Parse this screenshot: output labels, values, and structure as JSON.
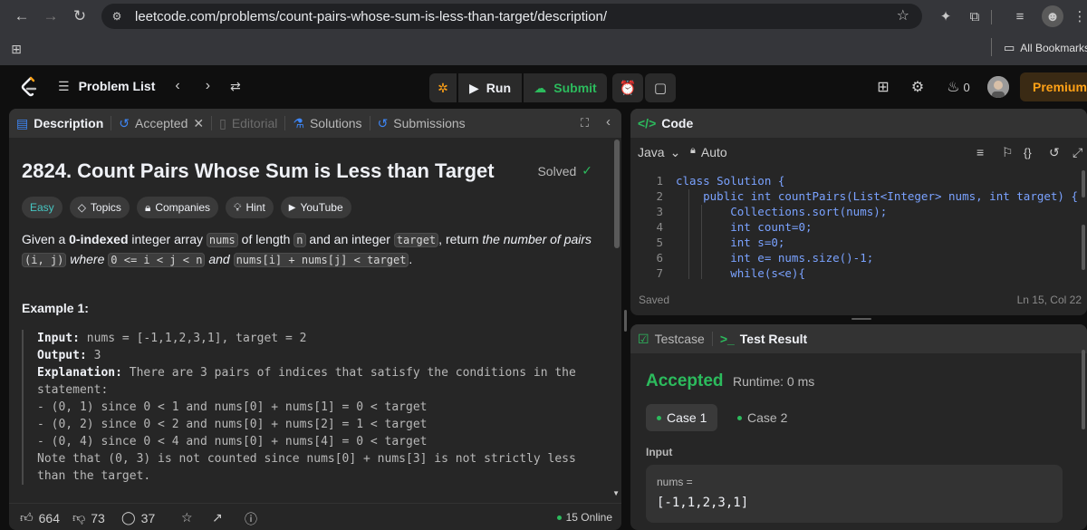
{
  "browser": {
    "url": "leetcode.com/problems/count-pairs-whose-sum-is-less-than-target/description/",
    "bookmarks_label": "All Bookmarks"
  },
  "header": {
    "problem_list": "Problem List",
    "run": "Run",
    "submit": "Submit",
    "streak_count": "0",
    "premium": "Premium"
  },
  "left_tabs": {
    "description": "Description",
    "accepted": "Accepted",
    "editorial": "Editorial",
    "solutions": "Solutions",
    "submissions": "Submissions"
  },
  "problem": {
    "title": "2824. Count Pairs Whose Sum is Less than Target",
    "solved": "Solved",
    "chips": {
      "difficulty": "Easy",
      "topics": "Topics",
      "companies": "Companies",
      "hint": "Hint",
      "youtube": "YouTube"
    },
    "desc": {
      "t1": "Given a ",
      "b1": "0-indexed",
      "t2": " integer array ",
      "c1": "nums",
      "t3": " of length ",
      "c2": "n",
      "t4": " and an integer ",
      "c3": "target",
      "t5": ", return ",
      "i1": "the number of pairs",
      "c4": "(i, j)",
      "i2": "where",
      "c5": "0 <= i < j < n",
      "i3": "and",
      "c6": "nums[i] + nums[j] < target",
      "t6": "."
    },
    "example_title": "Example 1:",
    "example": {
      "input_label": "Input:",
      "input_value": " nums = [-1,1,2,3,1], target = 2",
      "output_label": "Output:",
      "output_value": " 3",
      "explanation_label": "Explanation:",
      "explanation_value": " There are 3 pairs of indices that satisfy the conditions in the statement:\n- (0, 1) since 0 < 1 and nums[0] + nums[1] = 0 < target\n- (0, 2) since 0 < 2 and nums[0] + nums[2] = 1 < target\n- (0, 4) since 0 < 4 and nums[0] + nums[4] = 0 < target\nNote that (0, 3) is not counted since nums[0] + nums[3] is not strictly less than the target."
    }
  },
  "footer": {
    "likes": "664",
    "dislikes": "73",
    "comments": "37",
    "online": "15 Online"
  },
  "code_panel": {
    "title": "Code",
    "language": "Java",
    "format_mode": "Auto",
    "status": "Saved",
    "cursor": "Ln 15, Col 22",
    "lines": [
      {
        "n": "1",
        "code": "class Solution {"
      },
      {
        "n": "2",
        "code": "    public int countPairs(List<Integer> nums, int target) {"
      },
      {
        "n": "3",
        "code": "        Collections.sort(nums);"
      },
      {
        "n": "4",
        "code": "        int count=0;"
      },
      {
        "n": "5",
        "code": "        int s=0;"
      },
      {
        "n": "6",
        "code": "        int e= nums.size()-1;"
      },
      {
        "n": "7",
        "code": "        while(s<e){"
      }
    ]
  },
  "test_panel": {
    "testcase_tab": "Testcase",
    "result_tab": "Test Result",
    "verdict": "Accepted",
    "runtime": "Runtime: 0 ms",
    "case1": "Case 1",
    "case2": "Case 2",
    "input_label": "Input",
    "param_name": "nums =",
    "param_value": "[-1,1,2,3,1]"
  },
  "colors": {
    "accent_green": "#2cbb5d",
    "premium_orange": "#ffa116",
    "easy_teal": "#46c6c2",
    "link_blue": "#3e86f5"
  }
}
